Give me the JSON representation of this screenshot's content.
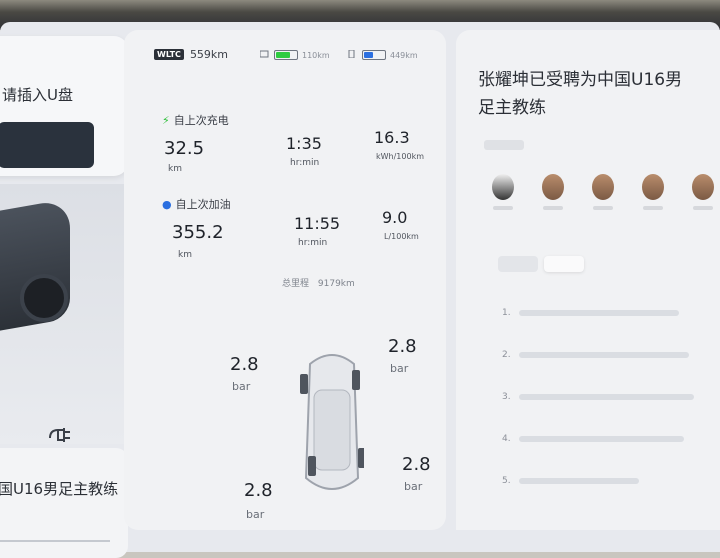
{
  "left": {
    "usb_prompt": "请插入U盘",
    "news_title": "国U16男足主教练"
  },
  "trip": {
    "wltc_badge": "WLTC",
    "wltc_range": "559km",
    "ev_range": "110km",
    "fuel_range": "449km",
    "since_charge": {
      "title": "自上次充电",
      "distance": "32.5",
      "distance_unit": "km",
      "time": "1:35",
      "time_unit": "hr:min",
      "consumption": "16.3",
      "consumption_unit": "kWh/100km"
    },
    "since_refuel": {
      "title": "自上次加油",
      "distance": "355.2",
      "distance_unit": "km",
      "time": "11:55",
      "time_unit": "hr:min",
      "consumption": "9.0",
      "consumption_unit": "L/100km"
    },
    "total_label": "总里程",
    "total_value": "9179km"
  },
  "tires": {
    "front_left": "2.8",
    "front_right": "2.8",
    "rear_left": "2.8",
    "rear_right": "2.8",
    "unit": "bar"
  },
  "news": {
    "headline": "张耀坤已受聘为中国U16男足主教练",
    "list_numbers": [
      "1.",
      "2.",
      "3.",
      "4.",
      "5."
    ]
  },
  "colors": {
    "ev_battery": "#2ecc40",
    "fuel_indicator": "#2b6fe0",
    "charge_icon": "#2fbf3a",
    "fuel_icon": "#2b6fe0"
  }
}
